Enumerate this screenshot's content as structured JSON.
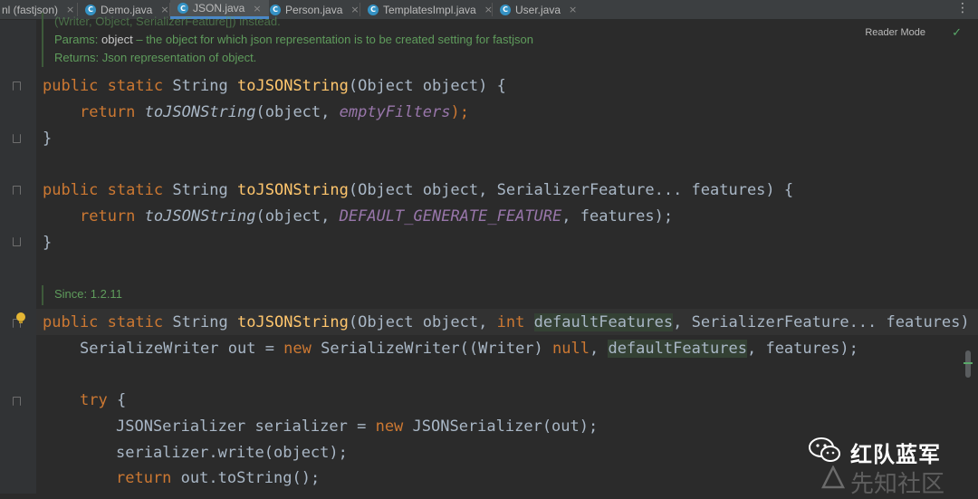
{
  "tabs": [
    {
      "label": "nl (fastjson)",
      "icon": "",
      "active": false
    },
    {
      "label": "Demo.java",
      "icon": "C",
      "active": false
    },
    {
      "label": "JSON.java",
      "icon": "C",
      "active": true
    },
    {
      "label": "Person.java",
      "icon": "C",
      "active": false
    },
    {
      "label": "TemplatesImpl.java",
      "icon": "C",
      "active": false
    },
    {
      "label": "User.java",
      "icon": "C",
      "active": false
    }
  ],
  "close_glyph": "×",
  "more_glyph": "⋮",
  "editor": {
    "reader_mode": "Reader Mode",
    "doc1": {
      "clipped": "(Writer, Object, SerializerFeature[]) instead.",
      "params_label": "Params:",
      "params_name": "object",
      "params_text": " – the object for which json representation is to be created setting for fastjson",
      "returns": "Returns: Json representation of object."
    },
    "doc2": {
      "since": "Since: 1.2.11"
    }
  },
  "code": {
    "l1": {
      "kw1": "public",
      "kw2": "static",
      "t1": "String",
      "fn": "toJSONString",
      "t2": "(Object object) {"
    },
    "l2": {
      "kw": "return",
      "fn": "toJSONString",
      "t1": "(object, ",
      "field": "emptyFilters",
      "t2": ");"
    },
    "l3": {
      "t": "}"
    },
    "l4": {
      "kw1": "public",
      "kw2": "static",
      "t1": "String",
      "fn": "toJSONString",
      "t2": "(Object object, SerializerFeature... features) {"
    },
    "l5": {
      "kw": "return",
      "fn": "toJSONString",
      "t1": "(object, ",
      "field": "DEFAULT_GENERATE_FEATURE",
      "t2": ", features);"
    },
    "l6": {
      "t": "}"
    },
    "l7": {
      "kw1": "public",
      "kw2": "static",
      "t1": "String",
      "fn": "toJSONString",
      "t2": "(Object object, ",
      "kw3": "int",
      "hl": "defaultFeatures",
      "t3": ", SerializerFeature... features) {"
    },
    "l8": {
      "t1": "SerializeWriter out = ",
      "kw1": "new",
      "t2": "SerializeWriter((Writer) ",
      "kw2": "null",
      "t3": ", ",
      "hl": "defaultFeatures",
      "t4": ", features);"
    },
    "l9": {
      "kw": "try",
      "t": " {"
    },
    "l10": {
      "t1": "JSONSerializer serializer = ",
      "kw": "new",
      "t2": " JSONSerializer(out);"
    },
    "l11": {
      "t": "serializer.write(object);"
    },
    "l12": {
      "kw": "return",
      "t": " out.toString();"
    }
  },
  "watermark": {
    "title": "红队蓝军",
    "subtitle": "先知社区"
  },
  "colors": {
    "keyword": "#cc7832",
    "method": "#ffc66d",
    "field": "#9876aa",
    "doc": "#5f9c5c",
    "background": "#2b2b2b"
  }
}
